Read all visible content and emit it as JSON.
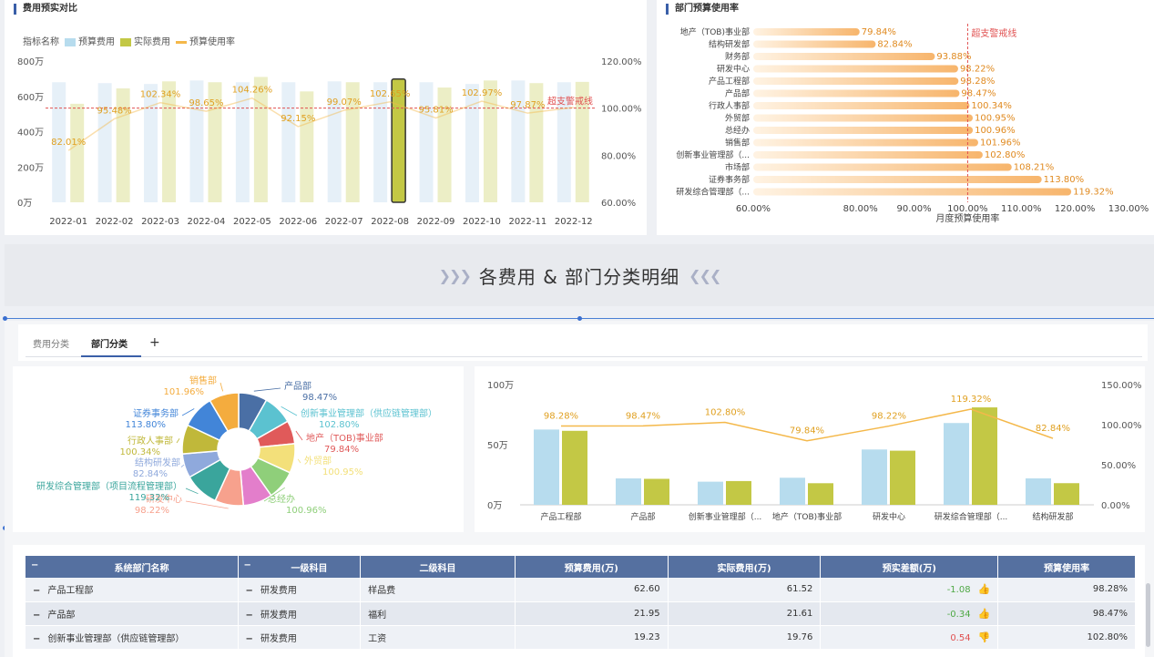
{
  "budget_panel": {
    "title": "费用预实对比",
    "legend": {
      "label": "指标名称",
      "budget": "预算费用",
      "actual": "实际费用",
      "rate": "预算使用率"
    },
    "warn_label": "超支警戒线"
  },
  "dept_panel": {
    "title": "部门预算使用率",
    "warn_label": "超支警戒线",
    "xlabel": "月度预算使用率"
  },
  "banner": {
    "title": "各费用 & 部门分类明细",
    "left_arrows": "❯❯❯",
    "right_arrows": "❮❮❮"
  },
  "tabs": [
    {
      "label": "费用分类"
    },
    {
      "label": "部门分类"
    }
  ],
  "tab_add": "+",
  "colors": {
    "budget": "#b7dcee",
    "actual": "#c3c845",
    "rate": "#f4b84a",
    "warn": "#e05050",
    "header": "#5570a0"
  },
  "chart_data": [
    {
      "type": "bar",
      "title": "费用预实对比",
      "categories": [
        "2022-01",
        "2022-02",
        "2022-03",
        "2022-04",
        "2022-05",
        "2022-06",
        "2022-07",
        "2022-08",
        "2022-09",
        "2022-10",
        "2022-11",
        "2022-12"
      ],
      "series": [
        {
          "name": "预算费用",
          "values": [
            680,
            675,
            670,
            690,
            680,
            680,
            685,
            680,
            680,
            670,
            690,
            680
          ]
        },
        {
          "name": "实际费用",
          "values": [
            558,
            645,
            685,
            680,
            710,
            628,
            680,
            698,
            650,
            690,
            675,
            682
          ]
        },
        {
          "name": "预算使用率",
          "axis": "right",
          "values": [
            82.01,
            95.48,
            102.34,
            98.65,
            104.26,
            92.15,
            99.07,
            102.65,
            95.81,
            102.97,
            97.87,
            100.3
          ]
        }
      ],
      "rate_labels": [
        "82.01%",
        "95.48%",
        "102.34%",
        "98.65%",
        "104.26%",
        "92.15%",
        "99.07%",
        "102.65%",
        "95.81%",
        "102.97%",
        "97.87%",
        ""
      ],
      "ylim": [
        0,
        800
      ],
      "yticks": [
        "0万",
        "200万",
        "400万",
        "600万",
        "800万"
      ],
      "y2lim": [
        60,
        120
      ],
      "y2ticks": [
        "60.00%",
        "80.00%",
        "100.00%",
        "120.00%"
      ],
      "warn_line": 100,
      "highlight": "2022-08"
    },
    {
      "type": "bar",
      "orientation": "horizontal",
      "title": "部门预算使用率",
      "categories": [
        "地产（TOB)事业部",
        "结构研发部",
        "财务部",
        "研发中心",
        "产品工程部",
        "产品部",
        "行政人事部",
        "外贸部",
        "总经办",
        "销售部",
        "创新事业管理部（...",
        "市场部",
        "证券事务部",
        "研发综合管理部（..."
      ],
      "values": [
        79.84,
        82.84,
        93.88,
        98.22,
        98.28,
        98.47,
        100.34,
        100.95,
        100.96,
        101.96,
        102.8,
        108.21,
        113.8,
        119.32
      ],
      "value_labels": [
        "79.84%",
        "82.84%",
        "93.88%",
        "98.22%",
        "98.28%",
        "98.47%",
        "100.34%",
        "100.95%",
        "100.96%",
        "101.96%",
        "102.80%",
        "108.21%",
        "113.80%",
        "119.32%"
      ],
      "xlim": [
        60,
        130
      ],
      "xticks": [
        "60.00%",
        "80.00%",
        "90.00%",
        "100.00%",
        "110.00%",
        "120.00%",
        "130.00%"
      ],
      "xlabel": "月度预算使用率",
      "warn_line": 100
    },
    {
      "type": "pie",
      "style": "donut",
      "slices": [
        {
          "name": "产品部",
          "value": 98.47,
          "label": "98.47%",
          "color": "#4a6fa5"
        },
        {
          "name": "创新事业管理部（供应链管理部）",
          "value": 102.8,
          "label": "102.80%",
          "color": "#5bc2d0"
        },
        {
          "name": "地产（TOB)事业部",
          "value": 79.84,
          "label": "79.84%",
          "color": "#e05a5a"
        },
        {
          "name": "外贸部",
          "value": 100.95,
          "label": "100.95%",
          "color": "#f3e07a"
        },
        {
          "name": "总经办",
          "value": 100.96,
          "label": "100.96%",
          "color": "#8fcf7a"
        },
        {
          "name": "",
          "value": 100.96,
          "label": "",
          "color": "#e37ecb"
        },
        {
          "name": "研发中心",
          "value": 98.22,
          "label": "98.22%",
          "color": "#f7a18d"
        },
        {
          "name": "研发综合管理部（项目流程管理部）",
          "value": 119.32,
          "label": "119.32%",
          "color": "#3aa59c"
        },
        {
          "name": "结构研发部",
          "value": 82.84,
          "label": "82.84%",
          "color": "#8fa9dc"
        },
        {
          "name": "行政人事部",
          "value": 100.34,
          "label": "100.34%",
          "color": "#c0b83a"
        },
        {
          "name": "证券事务部",
          "value": 113.8,
          "label": "113.80%",
          "color": "#4285d8"
        },
        {
          "name": "销售部",
          "value": 101.96,
          "label": "101.96%",
          "color": "#f4ac3e"
        }
      ]
    },
    {
      "type": "bar",
      "categories": [
        "产品工程部",
        "产品部",
        "创新事业管理部（...",
        "地产（TOB)事业部",
        "研发中心",
        "研发综合管理部（...",
        "结构研发部"
      ],
      "series": [
        {
          "name": "预算费用",
          "values": [
            62.6,
            21.95,
            19.23,
            22.5,
            46,
            68,
            22
          ]
        },
        {
          "name": "实际费用",
          "values": [
            61.52,
            21.61,
            19.76,
            17.96,
            45,
            81,
            18
          ]
        },
        {
          "name": "预算使用率",
          "axis": "right",
          "values": [
            98.28,
            98.47,
            102.8,
            79.84,
            98.22,
            119.32,
            82.84
          ]
        }
      ],
      "rate_labels": [
        "98.28%",
        "98.47%",
        "102.80%",
        "79.84%",
        "98.22%",
        "119.32%",
        "82.84%"
      ],
      "ylim": [
        0,
        100
      ],
      "yticks": [
        "0万",
        "50万",
        "100万"
      ],
      "y2lim": [
        0,
        150
      ],
      "y2ticks": [
        "0.00%",
        "50.00%",
        "100.00%",
        "150.00%"
      ]
    }
  ],
  "table": {
    "headers": [
      "系统部门名称",
      "一级科目",
      "二级科目",
      "预算费用(万)",
      "实际费用(万)",
      "预实差额(万)",
      "预算使用率"
    ],
    "rows": [
      {
        "dept": "产品工程部",
        "l1": "研发费用",
        "l2": "样品费",
        "budget": "62.60",
        "actual": "61.52",
        "diff": "-1.08",
        "rate": "98.28%",
        "trend": "up"
      },
      {
        "dept": "产品部",
        "l1": "研发费用",
        "l2": "福利",
        "budget": "21.95",
        "actual": "21.61",
        "diff": "-0.34",
        "rate": "98.47%",
        "trend": "up"
      },
      {
        "dept": "创新事业管理部（供应链管理部）",
        "l1": "研发费用",
        "l2": "工资",
        "budget": "19.23",
        "actual": "19.76",
        "diff": "0.54",
        "rate": "102.80%",
        "trend": "down"
      }
    ]
  }
}
